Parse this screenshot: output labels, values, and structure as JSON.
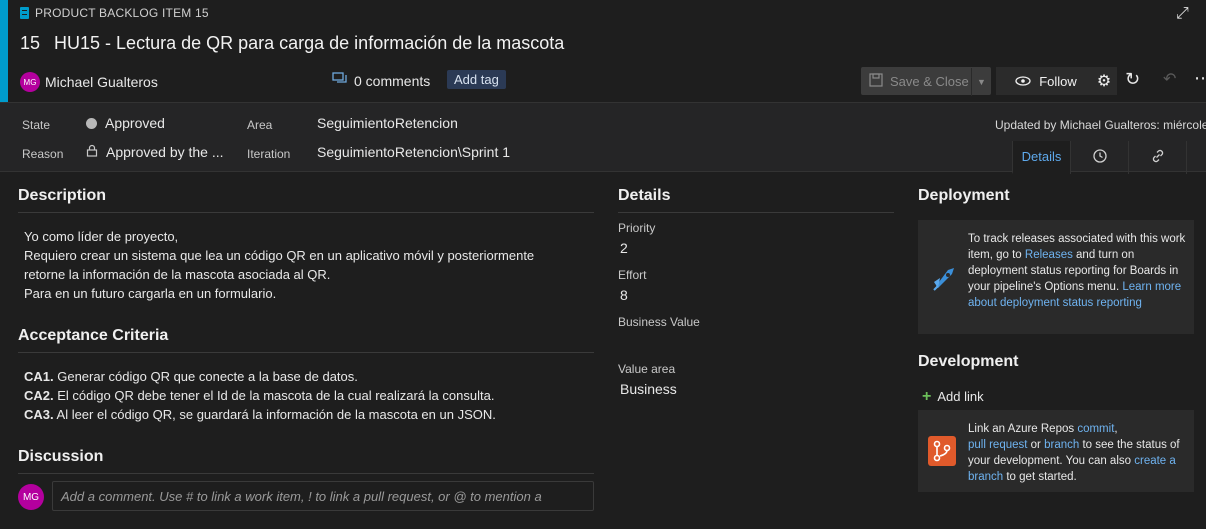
{
  "header": {
    "type_label": "PRODUCT BACKLOG ITEM 15",
    "id": "15",
    "title": "HU15 - Lectura de QR para carga de información de la mascota",
    "owner_initials": "MG",
    "owner_name": "Michael Gualteros",
    "comments": "0 comments",
    "add_tag": "Add tag",
    "save_close": "Save & Close",
    "follow": "Follow",
    "accent_color": "#009ccc"
  },
  "fields": {
    "state_label": "State",
    "state_value": "Approved",
    "reason_label": "Reason",
    "reason_value": "Approved by the ...",
    "area_label": "Area",
    "area_value": "SeguimientoRetencion",
    "iteration_label": "Iteration",
    "iteration_value": "SeguimientoRetencion\\Sprint 1",
    "updated": "Updated by Michael Gualteros: miércole",
    "tab_details": "Details"
  },
  "description": {
    "title": "Description",
    "lines": [
      "Yo como líder de proyecto,",
      "Requiero crear un sistema que lea un código QR en un aplicativo móvil y posteriormente",
      "retorne la información de la mascota asociada al QR.",
      "Para en un futuro cargarla en un formulario."
    ]
  },
  "acceptance": {
    "title": "Acceptance Criteria",
    "items": [
      {
        "code": "CA1.",
        "text": " Generar código QR que conecte a la base de datos."
      },
      {
        "code": "CA2.",
        "text": " El código QR debe tener el Id de la mascota de la cual realizará la consulta."
      },
      {
        "code": "CA3.",
        "text": " Al leer el código QR, se guardará la información de la mascota en un JSON."
      }
    ]
  },
  "discussion": {
    "title": "Discussion",
    "avatar": "MG",
    "placeholder": "Add a comment. Use # to link a work item, ! to link a pull request, or @ to mention a"
  },
  "details": {
    "title": "Details",
    "priority_label": "Priority",
    "priority_value": "2",
    "effort_label": "Effort",
    "effort_value": "8",
    "business_value_label": "Business Value",
    "value_area_label": "Value area",
    "value_area_value": "Business"
  },
  "deployment": {
    "title": "Deployment",
    "text_a": "To track releases associated with this work item, go to ",
    "link_releases": "Releases",
    "text_b": " and turn on deployment status reporting for Boards in your pipeline's Options menu. ",
    "link_learn": "Learn more about deployment status reporting"
  },
  "development": {
    "title": "Development",
    "add_link": "Add link",
    "text_a": "Link an Azure Repos ",
    "link_commit": "commit",
    "text_b": ",",
    "link_pr": "pull request",
    "text_c": " or ",
    "link_branch": "branch",
    "text_d": " to see the status of your development. You can also ",
    "link_create": "create a branch",
    "text_e": " to get started."
  }
}
